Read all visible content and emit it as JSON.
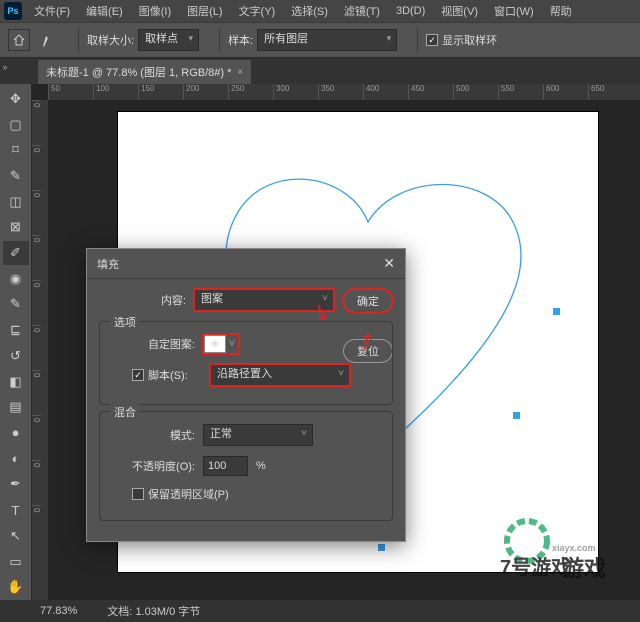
{
  "menu": {
    "items": [
      "文件(F)",
      "编辑(E)",
      "图像(I)",
      "图层(L)",
      "文字(Y)",
      "选择(S)",
      "滤镜(T)",
      "3D(D)",
      "视图(V)",
      "窗口(W)",
      "帮助"
    ]
  },
  "options": {
    "sample_size_label": "取样大小:",
    "sample_size_value": "取样点",
    "sample_label": "样本:",
    "sample_value": "所有图层",
    "show_ring": "显示取样环"
  },
  "tab": {
    "title": "未标题-1 @ 77.8% (图层 1, RGB/8#) *"
  },
  "ruler_h": [
    "50",
    "100",
    "150",
    "200",
    "250",
    "300",
    "350",
    "400",
    "450",
    "500",
    "550",
    "600",
    "650"
  ],
  "ruler_v": [
    "0",
    "0",
    "0",
    "0",
    "0",
    "0",
    "0",
    "0",
    "0",
    "0",
    "0"
  ],
  "status": {
    "zoom": "77.83%",
    "doc": "文档:",
    "size": "1.03M/0 字节"
  },
  "dialog": {
    "title": "填充",
    "content_label": "内容:",
    "content_value": "图案",
    "ok": "确定",
    "reset": "复位",
    "options_legend": "选项",
    "custom_pattern_label": "自定图案:",
    "script_label": "脚本(S):",
    "script_value": "沿路径置入",
    "blend_legend": "混合",
    "mode_label": "模式:",
    "mode_value": "正常",
    "opacity_label": "不透明度(O):",
    "opacity_value": "100",
    "opacity_suffix": "%",
    "preserve_trans": "保留透明区域(P)"
  },
  "watermark": {
    "line1": "7号游戏",
    "line2": "xiayx.com",
    "line3": "游戏"
  }
}
